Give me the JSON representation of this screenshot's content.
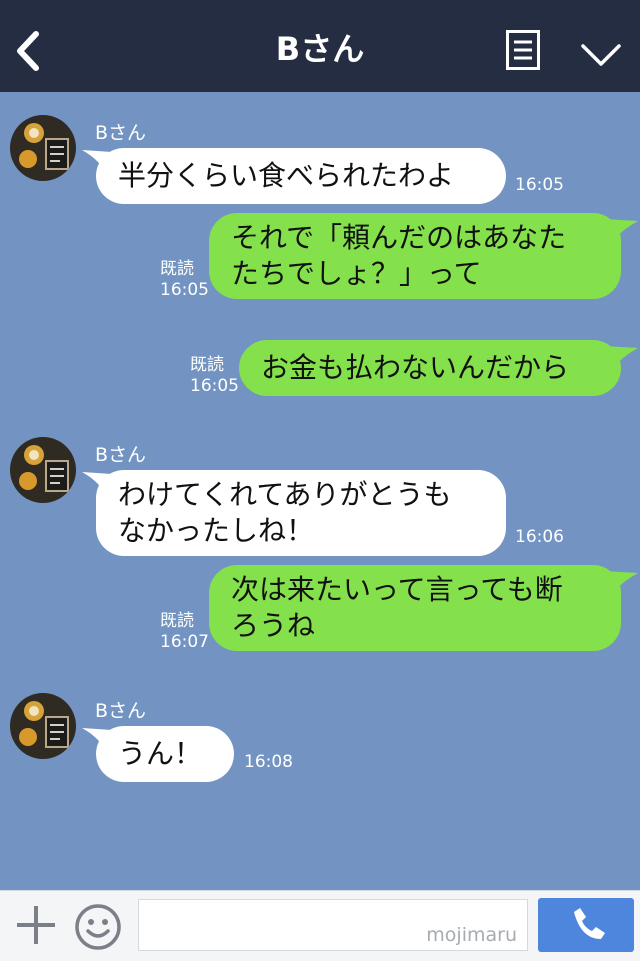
{
  "header": {
    "title": "Bさん"
  },
  "messages": [
    {
      "sender": "Bさん",
      "text": "半分くらい食べられたわよ",
      "time": "16:05"
    },
    {
      "text": "それで「頼んだのはあなた\nたちでしょ？」って",
      "read": "既読",
      "time": "16:05"
    },
    {
      "text": "お金も払わないんだから",
      "read": "既読",
      "time": "16:05"
    },
    {
      "sender": "Bさん",
      "text": "わけてくれてありがとうも\nなかったしね！",
      "time": "16:06"
    },
    {
      "text": "次は来たいって言っても断\nろうね",
      "read": "既読",
      "time": "16:07"
    },
    {
      "sender": "Bさん",
      "text": "うん！",
      "time": "16:08"
    }
  ],
  "input": {
    "value": "",
    "watermark": "mojimaru"
  },
  "colors": {
    "header": "#252d42",
    "background": "#7394c2",
    "outgoing": "#84e04b",
    "incoming": "#ffffff",
    "call_button": "#4f86dd"
  },
  "icons": {
    "back": "chevron-left-icon",
    "menu": "document-menu-icon",
    "collapse": "chevron-down-icon",
    "add": "plus-icon",
    "emoji": "smiley-icon",
    "call": "phone-icon"
  }
}
